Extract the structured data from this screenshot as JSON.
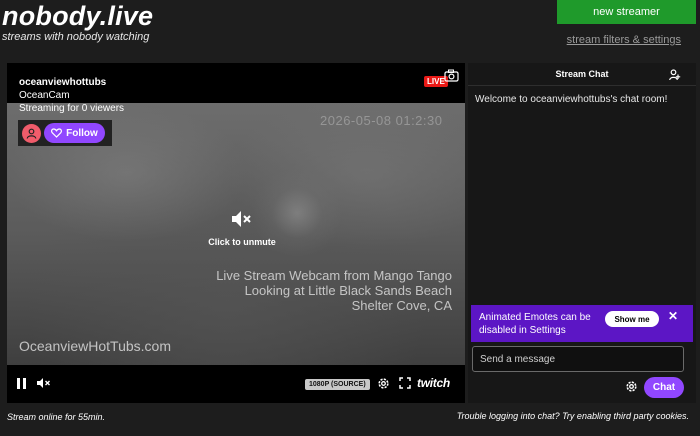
{
  "site": {
    "title": "nobody.live",
    "tagline": "streams with nobody watching"
  },
  "header": {
    "new_streamer_label": "new streamer",
    "filters_link": "stream filters & settings"
  },
  "player": {
    "channel": "oceanviewhottubs",
    "category": "OceanCam",
    "viewers_text": "Streaming for 0 viewers",
    "live_badge": "LIVE",
    "follow_label": "Follow",
    "timestamp": "2026-05-08 01:2:30",
    "overlay_line1": "Live Stream Webcam from Mango Tango",
    "overlay_line2": "Looking at Little Black Sands Beach",
    "overlay_line3": "Shelter Cove, CA",
    "watermark": "OceanviewHotTubs.com",
    "unmute_label": "Click to unmute",
    "quality": "1080P (SOURCE)",
    "brand": "twitch"
  },
  "chat": {
    "title": "Stream Chat",
    "welcome": "Welcome to oceanviewhottubs's chat room!",
    "emote_notice": "Animated Emotes can be disabled in Settings",
    "show_me_label": "Show me",
    "close_label": "✕",
    "input_placeholder": "Send a message",
    "send_label": "Chat"
  },
  "footer": {
    "status": "Stream online for 55min.",
    "help": "Trouble logging into chat? Try enabling third party cookies."
  },
  "colors": {
    "accent_purple": "#9147ff",
    "new_button_green": "#1f9a2b",
    "live_red": "#e91916",
    "notice_purple": "#5c16c5"
  },
  "icons": [
    "camera-icon",
    "user-icon",
    "heart-icon",
    "mute-icon",
    "pause-icon",
    "gear-icon",
    "fullscreen-icon",
    "users-icon"
  ]
}
